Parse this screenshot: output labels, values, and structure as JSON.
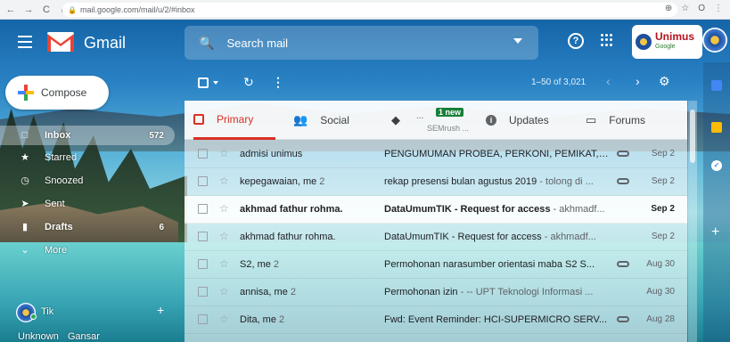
{
  "browser": {
    "url": "mail.google.com/mail/u/2/#inbox",
    "nav": {
      "back": "←",
      "forward": "→",
      "reload": "C",
      "home": "⌂"
    },
    "actions": [
      "⊕",
      "☆",
      "O",
      "⋮"
    ]
  },
  "header": {
    "brand": "Gmail",
    "search_placeholder": "Search mail",
    "help": "?",
    "org_name": "Unimus",
    "org_sub": "Google"
  },
  "sidebar": {
    "compose": "Compose",
    "items": [
      {
        "label": "Inbox",
        "count": "572",
        "icon": "inbox-icon"
      },
      {
        "label": "Starred",
        "count": "",
        "icon": "star-icon"
      },
      {
        "label": "Snoozed",
        "count": "",
        "icon": "clock-icon"
      },
      {
        "label": "Sent",
        "count": "",
        "icon": "send-icon"
      },
      {
        "label": "Drafts",
        "count": "6",
        "icon": "draft-icon"
      },
      {
        "label": "More",
        "count": "",
        "icon": "chevron-down-icon"
      }
    ],
    "hangouts_user": "Tik",
    "hangouts_add": "+",
    "bottom_user": "Unknown",
    "bottom_user2": "Gansar"
  },
  "toolbar": {
    "range": "1–50 of 3,021"
  },
  "tabs": [
    {
      "label": "Primary"
    },
    {
      "label": "Social"
    },
    {
      "label": "",
      "badge": "1 new",
      "sub": "SEMrush ...",
      "dots": "..."
    },
    {
      "label": "Updates"
    },
    {
      "label": "Forums"
    }
  ],
  "emails": [
    {
      "from": "admisi unimus",
      "count": "",
      "subject": "PENGUMUMAN PROBEA, PERKONI, PEMIKAT, ...",
      "snippet": "",
      "date": "Sep 2",
      "unread": false,
      "attach": true
    },
    {
      "from": "kepegawaian, me",
      "count": "2",
      "subject": "rekap presensi bulan agustus 2019",
      "snippet": " - tolong di ...",
      "date": "Sep 2",
      "unread": false,
      "attach": true
    },
    {
      "from": "akhmad fathur rohma.",
      "count": "",
      "subject": "DataUmumTIK - Request for access",
      "snippet": " - akhmadf...",
      "date": "Sep 2",
      "unread": true,
      "attach": false
    },
    {
      "from": "akhmad fathur rohma.",
      "count": "",
      "subject": "DataUmumTIK - Request for access",
      "snippet": " - akhmadf...",
      "date": "Sep 2",
      "unread": false,
      "attach": false
    },
    {
      "from": "S2, me",
      "count": "2",
      "subject": "Permohonan narasumber orientasi maba S2 S...",
      "snippet": "",
      "date": "Aug 30",
      "unread": false,
      "attach": true
    },
    {
      "from": "annisa, me",
      "count": "2",
      "subject": "Permohonan izin",
      "snippet": " - -- UPT Teknologi Informasi ...",
      "date": "Aug 30",
      "unread": false,
      "attach": false
    },
    {
      "from": "Dita, me",
      "count": "2",
      "subject": "Fwd: Event Reminder: HCI-SUPERMICRO SERV...",
      "snippet": "",
      "date": "Aug 28",
      "unread": false,
      "attach": true
    }
  ],
  "colors": {
    "accent": "#d93025",
    "badge": "#188038"
  }
}
